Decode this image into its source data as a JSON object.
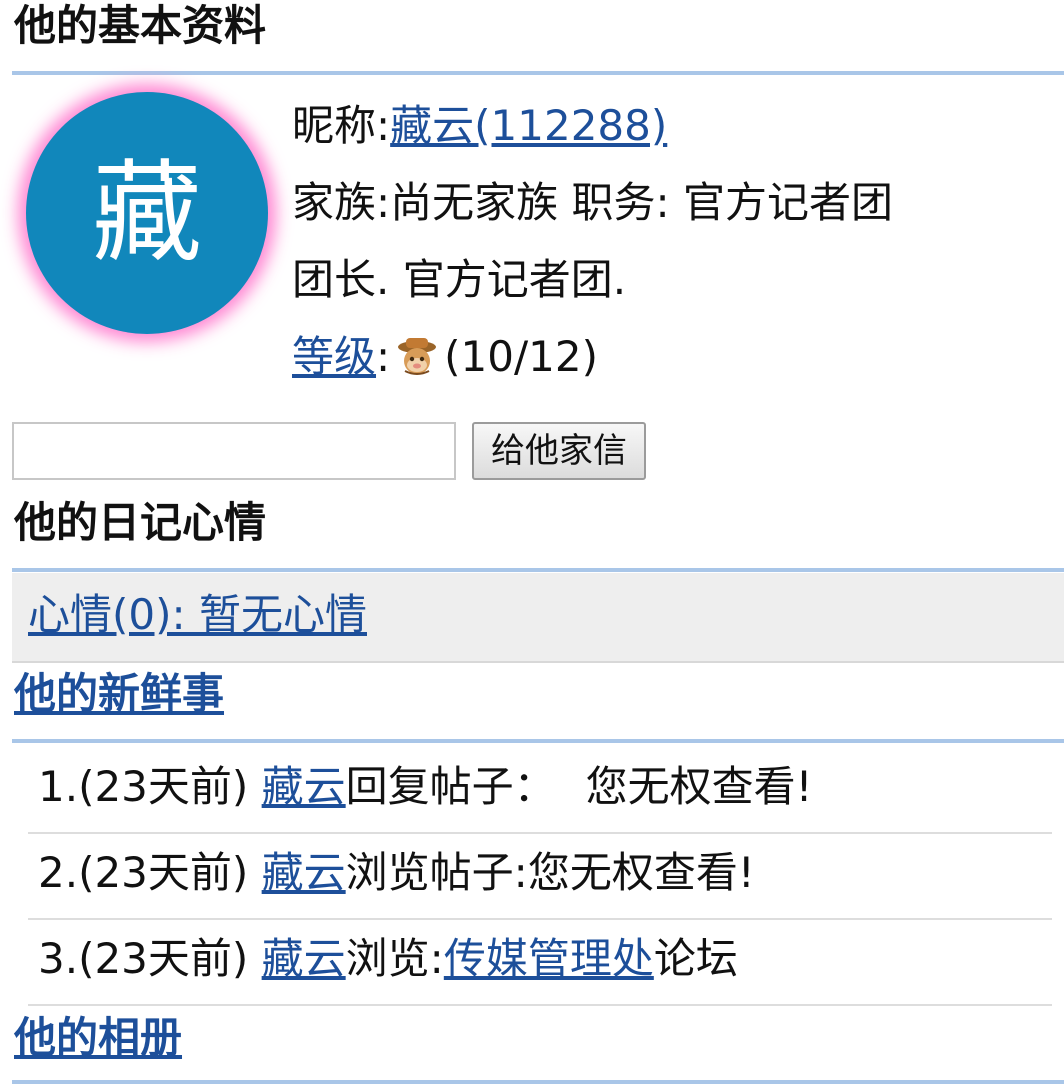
{
  "profile": {
    "section_title": "他的基本资料",
    "avatar_char": "藏",
    "nickname_label": "昵称:",
    "nickname_value": "藏云(112288)",
    "family_line_1": "家族:尚无家族 职务: 官方记者团",
    "family_line_2": "团长. 官方记者团.",
    "level_label": "等级",
    "level_colon": ":",
    "level_icon": "monkey-hat-icon",
    "level_value": "(10/12)"
  },
  "message": {
    "input_value": "",
    "input_placeholder": "",
    "button_label": "给他家信"
  },
  "diary": {
    "section_title": "他的日记心情",
    "mood_label": "心情(0): 暂无心情"
  },
  "feed": {
    "section_title": "他的新鲜事",
    "items": [
      {
        "prefix": "1.(23天前) ",
        "user": "藏云",
        "action": "回复帖子：",
        "detail": "您无权查看!"
      },
      {
        "prefix": "2.(23天前) ",
        "user": "藏云",
        "action": "浏览帖子:",
        "detail": "您无权查看!"
      },
      {
        "prefix": "3.(23天前) ",
        "user": "藏云",
        "action": "浏览:",
        "forum": "传媒管理处",
        "suffix": "论坛"
      }
    ]
  },
  "album": {
    "section_title": "他的相册"
  },
  "colors": {
    "link": "#1d4f9a",
    "rule": "#a9c6e8",
    "avatar_bg": "#1187bb",
    "avatar_glow": "#ff78cd"
  }
}
